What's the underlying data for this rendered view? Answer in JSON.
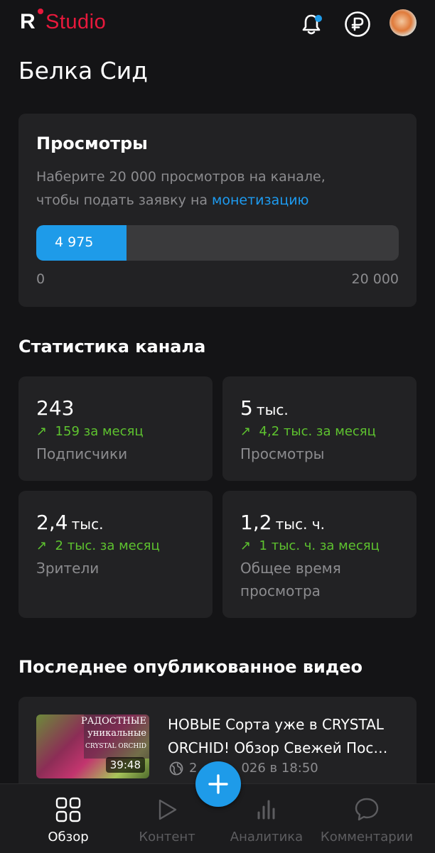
{
  "app": {
    "logo_r": "R",
    "logo_studio": "Studio"
  },
  "header": {
    "channel_name": "Белка Сид"
  },
  "views_card": {
    "title": "Просмотры",
    "description_1": "Наберите 20 000 просмотров на канале,",
    "description_2": "чтобы подать заявку на ",
    "link": "монетизацию",
    "progress_value": "4 975",
    "progress_fraction": 0.249,
    "range_min": "0",
    "range_max": "20 000"
  },
  "stats": {
    "title": "Статистика канала",
    "items": [
      {
        "value": "243",
        "unit": "",
        "delta": "159 за месяц",
        "label": "Подписчики",
        "label2": ""
      },
      {
        "value": "5",
        "unit": "тыс.",
        "delta": "4,2 тыс. за месяц",
        "label": "Просмотры",
        "label2": ""
      },
      {
        "value": "2,4",
        "unit": "тыс.",
        "delta": "2 тыс. за месяц",
        "label": "Зрители",
        "label2": ""
      },
      {
        "value": "1,2",
        "unit": "тыс. ч.",
        "delta": "1 тыс. ч. за месяц",
        "label": "Общее время",
        "label2": "просмотра"
      }
    ]
  },
  "latest_video": {
    "section_title": "Последнее опубликованное видео",
    "title_line1": "НОВЫЕ Сорта уже в CRYSTAL",
    "title_line2": "ORCHID! Обзор Свежей Пос…",
    "date_visible_1": "2",
    "date_visible_2": "026 в 18:50",
    "duration": "39:48",
    "thumb_text_1": "РАДОСТНЫЕ",
    "thumb_text_2": "уникальные",
    "thumb_text_3": "CRYSTAL ORCHID"
  },
  "nav": {
    "items": [
      {
        "label": "Обзор",
        "icon": "grid-icon",
        "active": true
      },
      {
        "label": "Контент",
        "icon": "play-icon",
        "active": false
      },
      {
        "label": "Аналитика",
        "icon": "bar-chart-icon",
        "active": false
      },
      {
        "label": "Комментарии",
        "icon": "chat-bubble-icon",
        "active": false
      }
    ]
  },
  "colors": {
    "accent": "#1e9be9",
    "brand": "#e8193c",
    "positive": "#5ec32f",
    "background": "#141416",
    "card": "#222224"
  }
}
